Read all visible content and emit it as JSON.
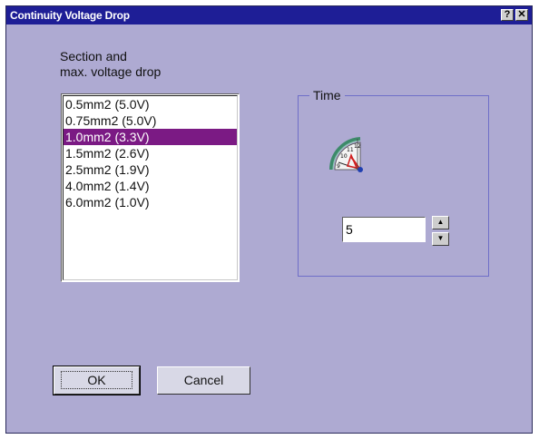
{
  "window": {
    "title": "Continuity Voltage Drop",
    "help_label": "?",
    "close_label": "✕"
  },
  "section": {
    "label_line1": "Section and",
    "label_line2": "max. voltage drop",
    "selected_index": 2,
    "items": [
      "0.5mm2  (5.0V)",
      "0.75mm2  (5.0V)",
      "1.0mm2  (3.3V)",
      "1.5mm2  (2.6V)",
      "2.5mm2  (1.9V)",
      "4.0mm2  (1.4V)",
      "6.0mm2  (1.0V)"
    ]
  },
  "time": {
    "group_title": "Time",
    "icon": "clock-timer-icon",
    "value": "5"
  },
  "buttons": {
    "ok": "OK",
    "cancel": "Cancel"
  },
  "colors": {
    "titlebar": "#1e1e96",
    "window_bg": "#aeaad2",
    "selection": "#7b1a84"
  }
}
